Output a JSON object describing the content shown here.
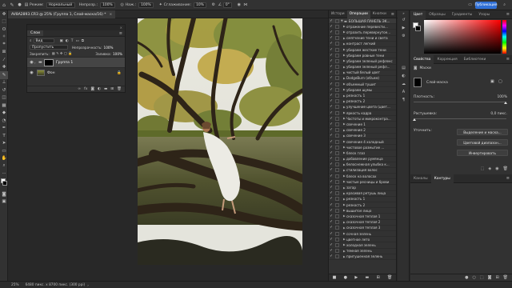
{
  "options_bar": {
    "mode_label": "Режим:",
    "mode_value": "Нормальный",
    "opacity_label": "Непрозр.:",
    "opacity_value": "100%",
    "flow_label": "Наж.:",
    "flow_value": "100%",
    "smoothing_label": "Сглаживание:",
    "smoothing_value": "10%",
    "angle_value": "0°",
    "share_label": "Публикация"
  },
  "document": {
    "tab_title": "AV8A2893.CR3 @ 25% (Группа 1, Слой-маска/16) *"
  },
  "layers_panel": {
    "tab_label": "Слои",
    "search_placeholder": "Вид",
    "blend_mode": "Пропустить",
    "opacity_label": "Непрозрачность:",
    "opacity_value": "100%",
    "lock_label": "Закрепить:",
    "fill_label": "Заливка:",
    "fill_value": "100%",
    "layers": [
      {
        "name": "Группа 1",
        "selected": true,
        "type": "group"
      },
      {
        "name": "Фон",
        "selected": false,
        "type": "background"
      }
    ]
  },
  "actions_panel": {
    "tabs": [
      "Истори",
      "Операции",
      "Кнопки"
    ],
    "active_tab": "Операции",
    "items": [
      "БОЛЬШАЯ ПАНЕЛЬ ЭК...",
      "отражение перевести...",
      "отразить перевернутое...",
      "смягчение тени и света",
      "контраст легкий",
      "убираем жесткие тени",
      "убираем ровные тени",
      "убираем зеленый рефлекс",
      "убираем зеленый рефл...",
      "чистый белый цвет",
      "DodgeBurn (объем)",
      "объемный тушит",
      "убираем шумы",
      "резкость 1",
      "резкость 2",
      "улучшение цвета (цвет...",
      "яркость кадра",
      "Частоты и микроконтра...",
      "свечение 1",
      "свечение 2",
      "свечение 3",
      "свечение 4 холодный",
      "чистовое размытие ...",
      "блеск глаз",
      "добавление румянца",
      "белоснежная улыбка к...",
      "стилизация волос",
      "блеск на волосах",
      "чистые ресницы и брови",
      "загар",
      "красивая ретушь лица",
      "резкость 1",
      "резкость 2",
      "вышитое лицо",
      "сказочная теплая 1",
      "сказочная теплая 2",
      "сказочная теплая 3",
      "сочная зелень",
      "цветное лето",
      "холодная зелень",
      "темная зелень",
      "пригушенная зелень"
    ]
  },
  "right_panels": {
    "color_tabs": [
      "Цвет",
      "Образцы",
      "Градиенты",
      "Узоры"
    ],
    "color_active": "Цвет",
    "props_tabs": [
      "Свойства",
      "Коррекция",
      "Библиотеки"
    ],
    "props_active": "Свойства",
    "mask_section": "Маски",
    "mask_type": "Слой-маска",
    "density_label": "Плотность:",
    "density_value": "100%",
    "feather_label": "Растушевка:",
    "feather_value": "0,0 пикс.",
    "refine_label": "Уточнить:",
    "select_mask_button": "Выделение и маска...",
    "color_range_button": "Цветовой диапазон...",
    "invert_button": "Инвертировать",
    "bottom_tabs": [
      "Каналы",
      "Контуры"
    ],
    "bottom_active": "Контуры"
  },
  "status_bar": {
    "zoom": "25%",
    "doc_info": "6480 пикс. x 8700 пикс. (300 ppi)"
  }
}
